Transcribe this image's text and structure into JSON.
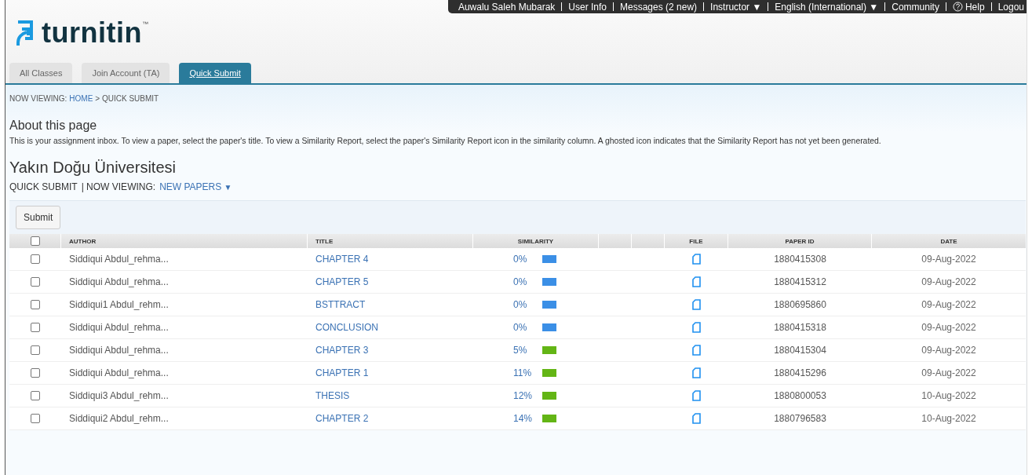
{
  "top_bar": {
    "items": [
      {
        "label": "Auwalu Saleh Mubarak",
        "kind": "text"
      },
      {
        "label": "User Info",
        "kind": "link"
      },
      {
        "label": "Messages (2 new)",
        "kind": "link"
      },
      {
        "label": "Instructor ▼",
        "kind": "link"
      },
      {
        "label": "English (International) ▼",
        "kind": "link"
      },
      {
        "label": "Community",
        "kind": "link"
      },
      {
        "label": "Help",
        "kind": "help"
      },
      {
        "label": "Logou",
        "kind": "link"
      }
    ]
  },
  "logo": {
    "text": "turnitin",
    "mark": "™"
  },
  "tabs": [
    {
      "label": "All Classes",
      "selected": false
    },
    {
      "label": "Join Account (TA)",
      "selected": false
    },
    {
      "label": "Quick Submit",
      "selected": true
    }
  ],
  "breadcrumb": {
    "prefix": "NOW VIEWING:",
    "link": "HOME",
    "rest": "> QUICK SUBMIT"
  },
  "about": {
    "title": "About this page",
    "text": "This is your assignment inbox. To view a paper, select the paper's title. To view a Similarity Report, select the paper's Similarity Report icon in the similarity column. A ghosted icon indicates that the Similarity Report has not yet been generated."
  },
  "class_title": "Yakın Doğu Üniversitesi",
  "view_bar": {
    "label": "QUICK SUBMIT",
    "prefix": "| NOW VIEWING:",
    "link": "NEW PAPERS",
    "caret": "▼"
  },
  "submit_button": "Submit",
  "table": {
    "select_all": {
      "checked": false
    },
    "columns": [
      "AUTHOR",
      "TITLE",
      "SIMILARITY",
      "FILE",
      "PAPER ID",
      "DATE"
    ],
    "rows": [
      {
        "checked": false,
        "author": "Siddiqui Abdul_rehma...",
        "title": "CHAPTER 4",
        "similarity": "0%",
        "color": "#3b8fe6",
        "paper_id": "1880415308",
        "date": "09-Aug-2022"
      },
      {
        "checked": false,
        "author": "Siddiqui Abdul_rehma...",
        "title": "CHAPTER 5",
        "similarity": "0%",
        "color": "#3b8fe6",
        "paper_id": "1880415312",
        "date": "09-Aug-2022"
      },
      {
        "checked": false,
        "author": "Siddiqui1 Abdul_rehm...",
        "title": "BSTTRACT",
        "similarity": "0%",
        "color": "#3b8fe6",
        "paper_id": "1880695860",
        "date": "09-Aug-2022"
      },
      {
        "checked": false,
        "author": "Siddiqui Abdul_rehma...",
        "title": "CONCLUSION",
        "similarity": "0%",
        "color": "#3b8fe6",
        "paper_id": "1880415318",
        "date": "09-Aug-2022"
      },
      {
        "checked": false,
        "author": "Siddiqui Abdul_rehma...",
        "title": "CHAPTER 3",
        "similarity": "5%",
        "color": "#63b515",
        "paper_id": "1880415304",
        "date": "09-Aug-2022"
      },
      {
        "checked": false,
        "author": "Siddiqui Abdul_rehma...",
        "title": "CHAPTER 1",
        "similarity": "11%",
        "color": "#63b515",
        "paper_id": "1880415296",
        "date": "09-Aug-2022"
      },
      {
        "checked": false,
        "author": "Siddiqui3 Abdul_rehm...",
        "title": "THESIS",
        "similarity": "12%",
        "color": "#63b515",
        "paper_id": "1880800053",
        "date": "10-Aug-2022"
      },
      {
        "checked": false,
        "author": "Siddiqui2 Abdul_rehm...",
        "title": "CHAPTER 2",
        "similarity": "14%",
        "color": "#63b515",
        "paper_id": "1880796583",
        "date": "10-Aug-2022"
      }
    ]
  }
}
